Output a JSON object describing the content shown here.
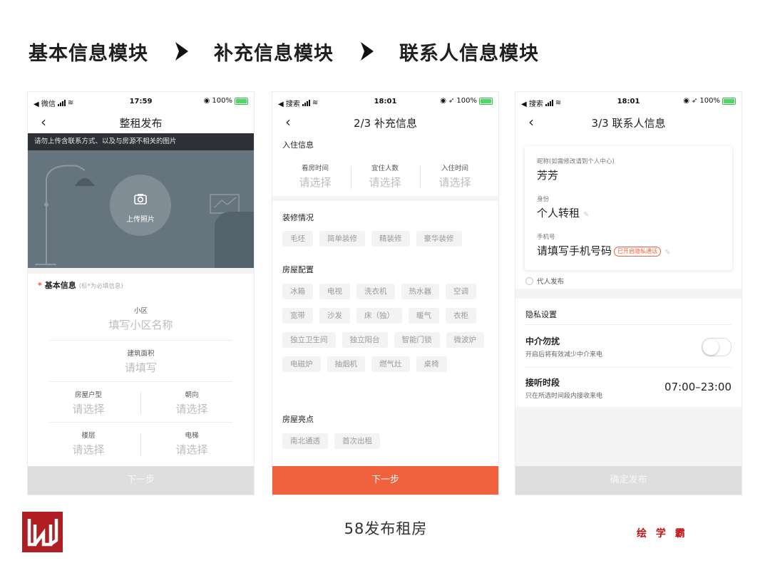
{
  "flow": {
    "step1": "基本信息模块",
    "step2": "补充信息模块",
    "step3": "联系人信息模块"
  },
  "phone1": {
    "status": {
      "left": "◀ 微信",
      "time": "17:59",
      "right": "100%"
    },
    "nav_title": "整租发布",
    "notice": "请勿上传含联系方式、以及与房源不相关的图片",
    "upload_label": "上传照片",
    "section_title": "基本信息",
    "section_hint": "(标*为必填信息)",
    "fields": {
      "community_label": "小区",
      "community_placeholder": "填写小区名称",
      "area_label": "建筑面积",
      "area_placeholder": "请填写",
      "layout_label": "房屋户型",
      "layout_placeholder": "请选择",
      "orientation_label": "朝向",
      "orientation_placeholder": "请选择",
      "floor_label": "楼层",
      "floor_placeholder": "请选择",
      "elevator_label": "电梯",
      "elevator_placeholder": "请选择"
    },
    "next_button": "下一步"
  },
  "phone2": {
    "status": {
      "left": "◀ 搜索",
      "time": "18:01",
      "right": "100%"
    },
    "nav_title": "2/3 补充信息",
    "checkin_title": "入住信息",
    "checkin_fields": [
      {
        "label": "看房时间",
        "placeholder": "请选择"
      },
      {
        "label": "宜住人数",
        "placeholder": "请选择"
      },
      {
        "label": "入住时间",
        "placeholder": "请选择"
      }
    ],
    "decoration_title": "装修情况",
    "decoration_options": [
      "毛坯",
      "简单装修",
      "精装修",
      "豪华装修"
    ],
    "facilities_title": "房屋配置",
    "facilities_options": [
      "冰箱",
      "电视",
      "洗衣机",
      "热水器",
      "空调",
      "宽带",
      "沙发",
      "床（独）",
      "暖气",
      "衣柜",
      "独立卫生间",
      "独立阳台",
      "智能门锁",
      "微波炉",
      "电磁炉",
      "抽烟机",
      "燃气灶",
      "桌椅"
    ],
    "highlights_title": "房屋亮点",
    "highlights_options": [
      "南北通透",
      "首次出租"
    ],
    "next_button": "下一步"
  },
  "phone3": {
    "status": {
      "left": "◀ 搜索",
      "time": "18:01",
      "right": "100%"
    },
    "nav_title": "3/3 联系人信息",
    "nickname_label": "昵称(如需修改请到个人中心)",
    "nickname_value": "芳芳",
    "identity_label": "身份",
    "identity_value": "个人转租",
    "phone_label": "手机号",
    "phone_placeholder": "请填写手机号码",
    "privacy_tag": "已开启隐私通话",
    "agent_option": "代人发布",
    "privacy_title": "隐私设置",
    "no_agent_title": "中介勿扰",
    "no_agent_desc": "开启后将有效减少中介来电",
    "answer_title": "接听时段",
    "answer_desc": "只在所选时间段内接收来电",
    "answer_value": "07:00–23:00",
    "submit_button": "确定发布"
  },
  "footer": {
    "caption": "58发布租房",
    "brand": "绘 学 霸"
  }
}
